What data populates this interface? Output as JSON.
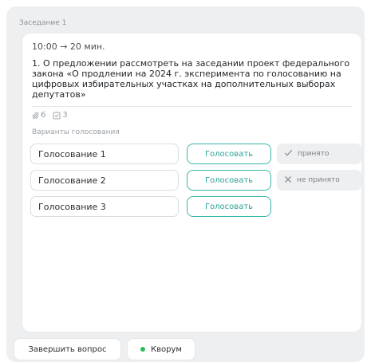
{
  "panel": {
    "title": "Заседание 1"
  },
  "question": {
    "time": "10:00 → 20 мин.",
    "text": "1. О предложении рассмотреть на заседании проект федерального закона «О продлении на 2024 г. эксперимента по голосованию на цифровых избирательных участках на дополнительных выборах депутатов»",
    "attachments_count": "6",
    "checks_count": "3"
  },
  "voting": {
    "label": "Варианты голосования",
    "options": [
      {
        "name": "Голосование 1",
        "button": "Голосовать",
        "status": "принято",
        "status_icon": "check-icon"
      },
      {
        "name": "Голосование 2",
        "button": "Голосовать",
        "status": "не принято",
        "status_icon": "cross-icon"
      },
      {
        "name": "Голосование 3",
        "button": "Голосовать",
        "status": null,
        "status_icon": null
      }
    ]
  },
  "footer": {
    "finish_label": "Завершить вопрос",
    "quorum_label": "Кворум",
    "quorum_color": "#2dbe5c"
  },
  "colors": {
    "accent": "#38b8a8",
    "panel_bg": "#eeeff1"
  }
}
